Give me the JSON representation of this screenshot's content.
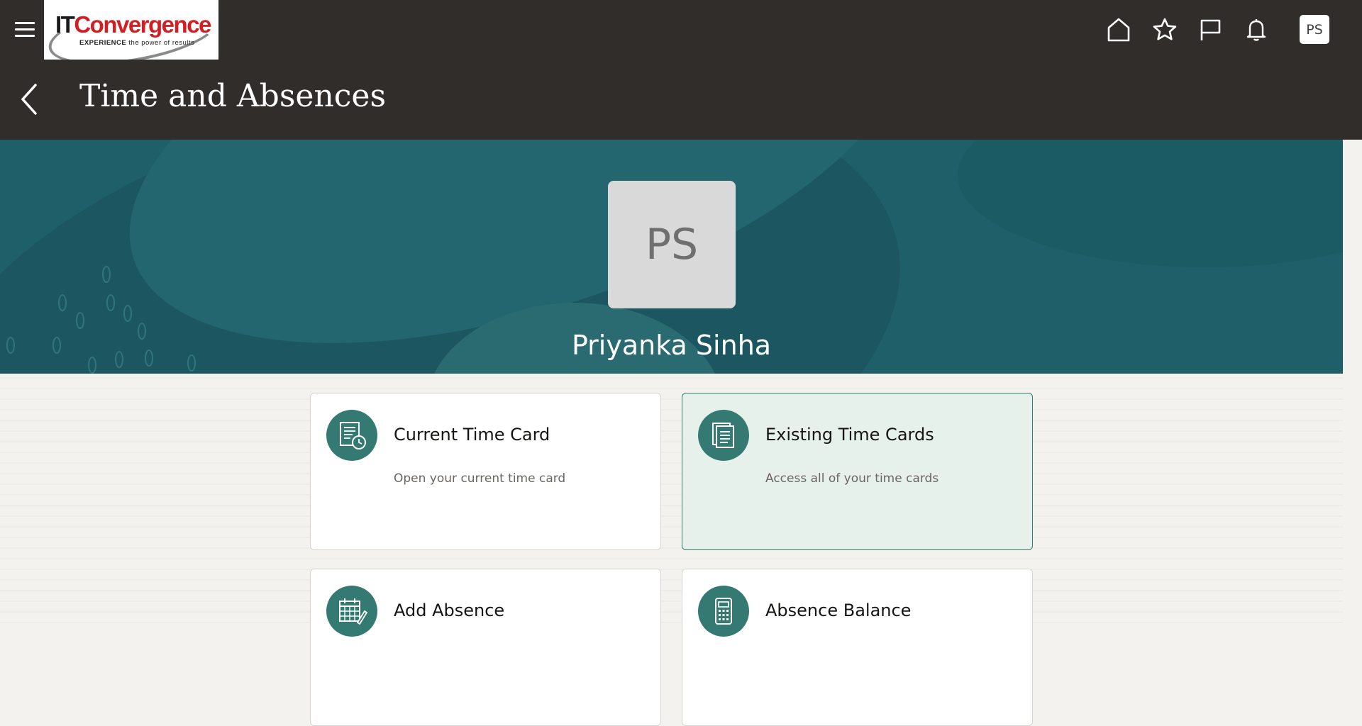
{
  "header": {
    "logo": {
      "brand_it": "IT",
      "brand_name": "Convergence",
      "tagline_bold": "EXPERIENCE",
      "tagline_rest": "the power of results"
    },
    "icons": [
      "menu-icon",
      "home-icon",
      "favorites-star-icon",
      "flag-icon",
      "notifications-bell-icon"
    ],
    "user_initials": "PS",
    "page_title": "Time and Absences"
  },
  "hero": {
    "avatar_initials": "PS",
    "person_name": "Priyanka Sinha",
    "background_color": "#1f5f69"
  },
  "cards": [
    {
      "title": "Current Time Card",
      "description": "Open your current time card",
      "icon": "time-card-clock-icon",
      "selected": false
    },
    {
      "title": "Existing Time Cards",
      "description": "Access all of your time cards",
      "icon": "stacked-documents-icon",
      "selected": true
    },
    {
      "title": "Add Absence",
      "description": "",
      "icon": "calendar-pencil-icon",
      "selected": false
    },
    {
      "title": "Absence Balance",
      "description": "",
      "icon": "calculator-icon",
      "selected": false
    }
  ],
  "colors": {
    "header_bg": "#312d2a",
    "accent_teal": "#347a72",
    "selected_card_bg": "#e7f1ec"
  }
}
